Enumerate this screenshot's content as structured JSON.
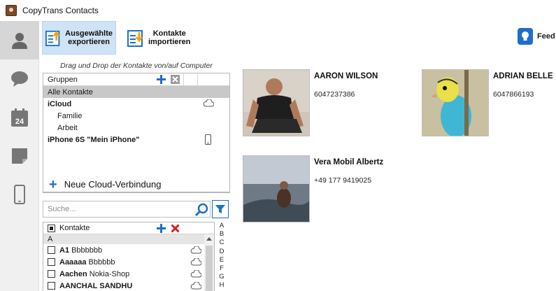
{
  "window": {
    "title": "CopyTrans Contacts"
  },
  "rail": {
    "items": [
      {
        "icon": "person-icon"
      },
      {
        "icon": "chat-bubble-icon"
      },
      {
        "icon": "calendar-icon",
        "label": "24"
      },
      {
        "icon": "note-icon"
      },
      {
        "icon": "phone-icon"
      }
    ]
  },
  "toolbar": {
    "export_label": "Ausgewählte\nexportieren",
    "import_label": "Kontakte\nimportieren",
    "feedback_label": "Feed"
  },
  "left": {
    "drag_hint": "Drag und Drop der Kontakte von/auf Computer",
    "groups_header": "Gruppen",
    "groups": [
      {
        "label": "Alle Kontakte"
      },
      {
        "label": "iCloud",
        "icon": "cloud-icon"
      },
      {
        "label": "Familie"
      },
      {
        "label": "Arbeit"
      },
      {
        "label": "iPhone 6S \"Mein iPhone\"",
        "icon": "phone-icon"
      }
    ],
    "new_cloud_label": "Neue Cloud-Verbindung",
    "search_placeholder": "Suche...",
    "contacts_header": "Kontakte",
    "letter": "A",
    "contacts": [
      {
        "last": "A1",
        "first": "Bbbbbbb"
      },
      {
        "last": "Aaaaaa",
        "first": "Bbbbbb"
      },
      {
        "last": "Aachen",
        "first": "Nokia-Shop"
      },
      {
        "last": "AANCHAL SANDHU",
        "first": ""
      }
    ],
    "alphabet": [
      "A",
      "B",
      "C",
      "D",
      "E",
      "F",
      "G",
      "H"
    ]
  },
  "cards": [
    {
      "name": "AARON WILSON",
      "phone": "6047237386"
    },
    {
      "name": "ADRIAN BELLE",
      "phone": "6047866193"
    },
    {
      "name": "Vera Mobil Albertz",
      "phone": "+49 177 9419025"
    }
  ],
  "colors": {
    "accent": "#1e6fc8",
    "selected_toolbar": "#cfe3f6",
    "rail_bg": "#f0f0f0"
  }
}
